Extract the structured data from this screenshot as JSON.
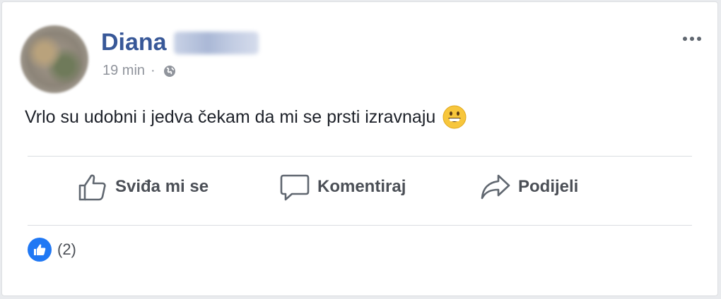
{
  "post": {
    "author_first_name": "Diana",
    "time": "19 min",
    "separator": "·",
    "text": "Vrlo su udobni i jedva čekam da mi se prsti izravnaju",
    "emoji": "grinning-face-emoji"
  },
  "actions": {
    "like_label": "Sviđa mi se",
    "comment_label": "Komentiraj",
    "share_label": "Podijeli"
  },
  "reactions": {
    "count_text": "(2)"
  },
  "colors": {
    "name": "#385898",
    "like_badge": "#2078f4",
    "action_text": "#4b4f56",
    "meta_text": "#90949c"
  }
}
